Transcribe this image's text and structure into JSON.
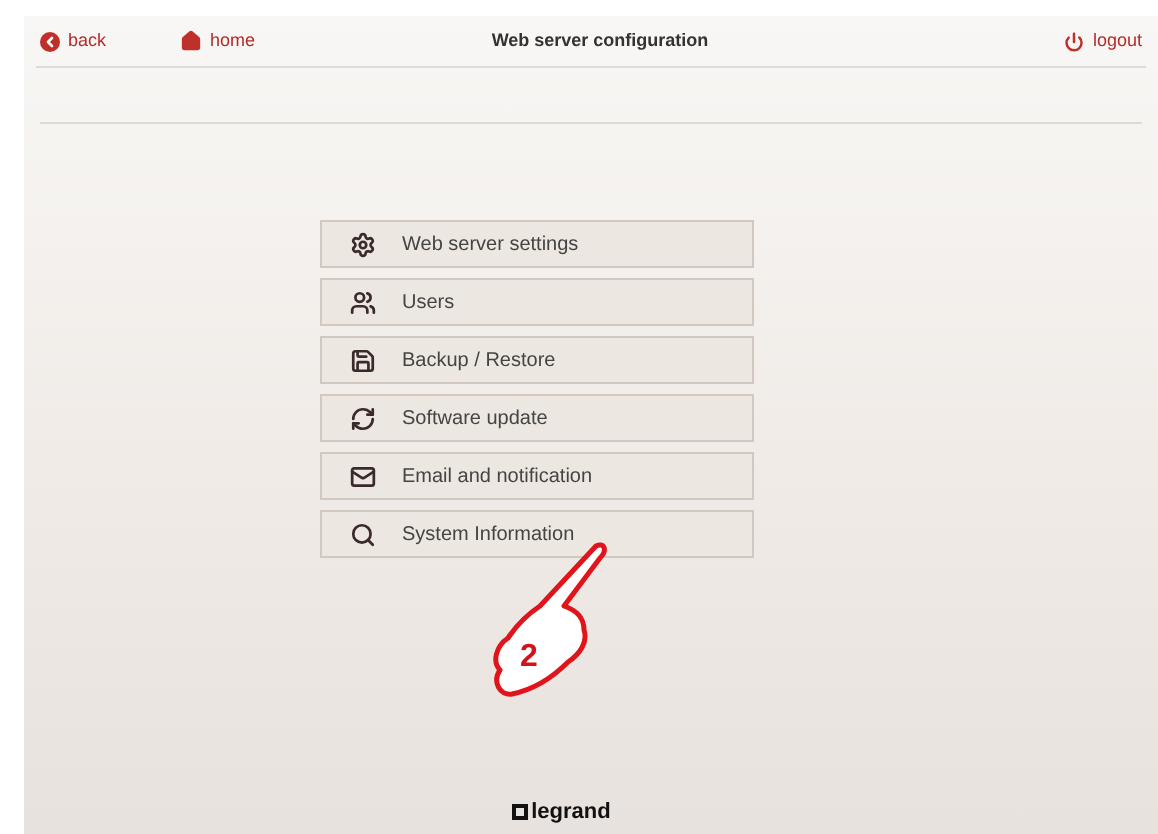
{
  "header": {
    "back": "back",
    "home": "home",
    "title": "Web server configuration",
    "logout": "logout"
  },
  "menu": [
    {
      "kind": "settings",
      "label": "Web server settings"
    },
    {
      "kind": "users",
      "label": "Users"
    },
    {
      "kind": "backup",
      "label": "Backup / Restore"
    },
    {
      "kind": "update",
      "label": "Software update"
    },
    {
      "kind": "email",
      "label": "Email and notification"
    },
    {
      "kind": "info",
      "label": "System Information"
    }
  ],
  "annotation": {
    "label": "2"
  },
  "footer": {
    "logo": "legrand"
  }
}
